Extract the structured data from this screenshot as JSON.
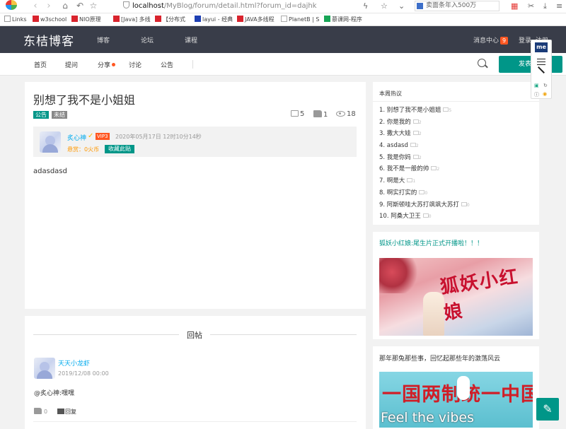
{
  "browser": {
    "url_host": "localhost",
    "url_path": "/MyBlog/forum/detail.html?forum_id=dajhk",
    "news_box": "卖面条年入500万",
    "bookmarks": [
      "Links",
      "w3school",
      "NIO原理",
      "[Java] 多线",
      "【分布式",
      "layui - 经典",
      "JAVA多线程",
      "PlanetB | S",
      "慕课网-程序"
    ]
  },
  "site": {
    "logo": "东桔博客",
    "nav": [
      "博客",
      "论坛",
      "课程"
    ],
    "message_center": "消息中心",
    "message_count": "9",
    "login": "登录",
    "register": "注册"
  },
  "subnav": {
    "items": [
      "首页",
      "提问",
      "分享",
      "讨论",
      "公告"
    ],
    "post_button": "发表新帖"
  },
  "post": {
    "title": "别想了我不是小姐姐",
    "tags": [
      "公告",
      "未结"
    ],
    "comments": "5",
    "likes": "1",
    "views": "18",
    "author": "炙心神",
    "vip": "VIP3",
    "date": "2020年05月17日 12时10分14秒",
    "reward": "悬赏：0火币",
    "collect": "收藏此贴",
    "content": "adasdasd"
  },
  "replies": {
    "title": "回帖",
    "items": [
      {
        "name": "天天小龙虾",
        "date": "2019/12/08 00:00",
        "text": "@炙心神:嘿嘿",
        "likes": "0",
        "reply_label": "回复"
      }
    ]
  },
  "sidebar": {
    "hot_title": "本周热议",
    "hot_items": [
      {
        "label": "1. 别想了我不是小姐姐",
        "count": "5"
      },
      {
        "label": "2. 你是我的",
        "count": "2"
      },
      {
        "label": "3. 撒大大娃",
        "count": "2"
      },
      {
        "label": "4. asdasd",
        "count": "2"
      },
      {
        "label": "5. 我是你妈",
        "count": "2"
      },
      {
        "label": "6. 我不是一般的帅",
        "count": "2"
      },
      {
        "label": "7. 啊是大",
        "count": "1"
      },
      {
        "label": "8. 啊实打实的",
        "count": "0"
      },
      {
        "label": "9. 阿斯顿哇大苏打飒飒大苏打",
        "count": "0"
      },
      {
        "label": "10. 阿桑大卫王",
        "count": "0"
      }
    ],
    "promo1_title": "狐妖小红娘:尾生片正式开播啦！！！",
    "promo1_image_text": "狐妖小红娘",
    "promo2_title": "那年那兔那些事，回忆起那些年的激荡风云",
    "promo2_image_text": "一国两制统一中国",
    "promo2_caption": "Feel the vibes"
  },
  "colors": {
    "accent": "#009688",
    "header_bg": "#393d49",
    "badge": "#ff5722",
    "link": "#01aaed"
  }
}
